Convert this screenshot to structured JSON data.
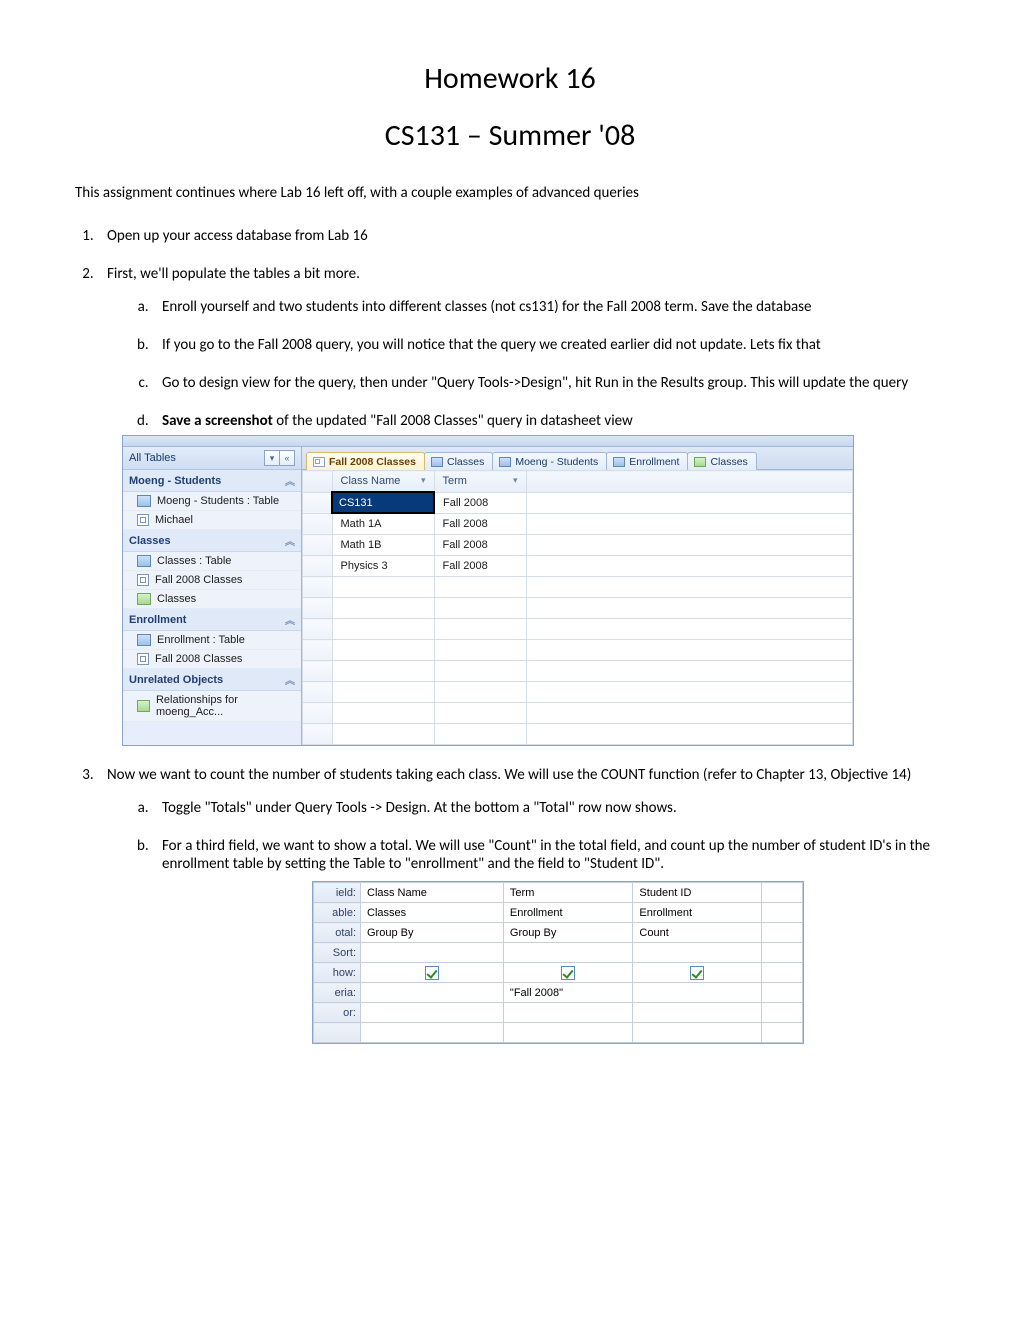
{
  "title": "Homework 16",
  "subtitle": "CS131 – Summer '08",
  "intro": "This assignment continues where Lab 16 left off, with a couple examples of advanced queries",
  "steps": {
    "s1": "Open up your access database from Lab 16",
    "s2": "First, we'll populate the tables a bit more.",
    "s2a": "Enroll yourself and two students into different classes (not cs131) for the Fall 2008 term.  Save the database",
    "s2b": "If you go to the Fall 2008 query, you will notice that the query we created earlier did not update.  Lets fix that",
    "s2c": "Go to design view for the query, then under \"Query Tools->Design\", hit Run in the Results group.  This will update the query",
    "s2d_pre": "Save a screenshot",
    "s2d_post": " of the updated \"Fall 2008 Classes\" query in datasheet view",
    "s3": " Now we want to count the number of students taking each class.  We will use the COUNT function (refer to Chapter 13, Objective 14)",
    "s3a": "Toggle \"Totals\" under Query Tools -> Design.  At the bottom a \"Total\" row now shows.",
    "s3b": "For a third field, we want to show a total.  We will use \"Count\" in the total field, and count up the number of student ID's in the enrollment table by setting the Table to \"enrollment\" and the field to \"Student ID\"."
  },
  "shot1": {
    "nav_header": "All Tables",
    "groups": [
      {
        "title": "Moeng - Students",
        "items": [
          {
            "icon": "table",
            "label": "Moeng - Students : Table"
          },
          {
            "icon": "query",
            "label": "Michael"
          }
        ]
      },
      {
        "title": "Classes",
        "items": [
          {
            "icon": "table",
            "label": "Classes : Table"
          },
          {
            "icon": "query",
            "label": "Fall 2008 Classes"
          },
          {
            "icon": "form",
            "label": "Classes"
          }
        ]
      },
      {
        "title": "Enrollment",
        "items": [
          {
            "icon": "table",
            "label": "Enrollment : Table"
          },
          {
            "icon": "query",
            "label": "Fall 2008 Classes"
          }
        ]
      },
      {
        "title": "Unrelated Objects",
        "items": [
          {
            "icon": "form",
            "label": "Relationships for moeng_Acc..."
          }
        ]
      }
    ],
    "tabs": [
      {
        "icon": "query",
        "label": "Fall 2008 Classes",
        "active": true
      },
      {
        "icon": "table",
        "label": "Classes"
      },
      {
        "icon": "table",
        "label": "Moeng - Students"
      },
      {
        "icon": "table",
        "label": "Enrollment"
      },
      {
        "icon": "form",
        "label": "Classes"
      }
    ],
    "columns": [
      "Class Name",
      "Term"
    ],
    "rows": [
      {
        "class": "CS131",
        "term": "Fall 2008",
        "selected": true
      },
      {
        "class": "Math 1A",
        "term": "Fall 2008"
      },
      {
        "class": "Math 1B",
        "term": "Fall 2008"
      },
      {
        "class": "Physics 3",
        "term": "Fall 2008"
      }
    ],
    "empty_rows": 8
  },
  "shot2": {
    "row_labels": [
      "ield:",
      "able:",
      "otal:",
      "Sort:",
      "how:",
      "eria:",
      "or:"
    ],
    "cols": [
      {
        "field": "Class Name",
        "table": "Classes",
        "total": "Group By",
        "sort": "",
        "show": true,
        "criteria": ""
      },
      {
        "field": "Term",
        "table": "Enrollment",
        "total": "Group By",
        "sort": "",
        "show": true,
        "criteria": "\"Fall 2008\""
      },
      {
        "field": "Student ID",
        "table": "Enrollment",
        "total": "Count",
        "sort": "",
        "show": true,
        "criteria": ""
      }
    ]
  }
}
